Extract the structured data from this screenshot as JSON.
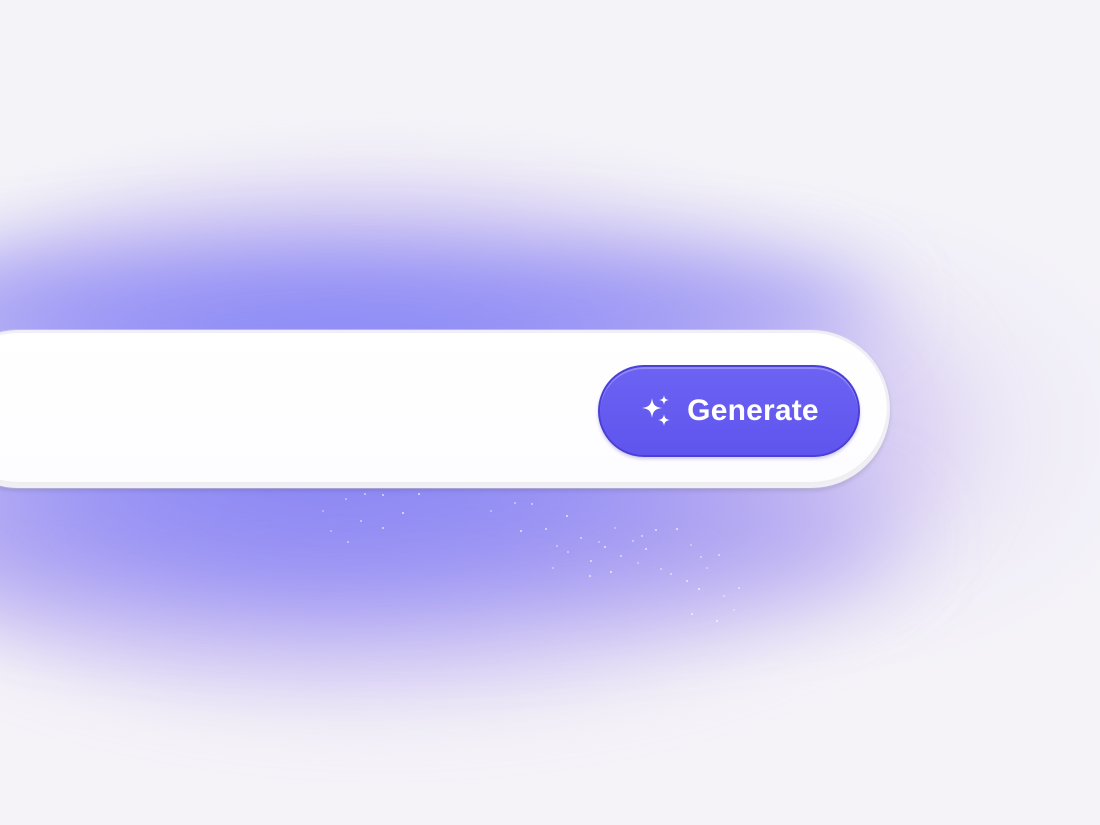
{
  "prompt_bar": {
    "input_value": "",
    "generate_label": "Generate",
    "generate_icon": "sparkles-icon"
  },
  "colors": {
    "accent": "#6259f0",
    "accent_border": "#4a3fd6",
    "glow": "#7c78f5",
    "background": "#f4f3f8"
  }
}
